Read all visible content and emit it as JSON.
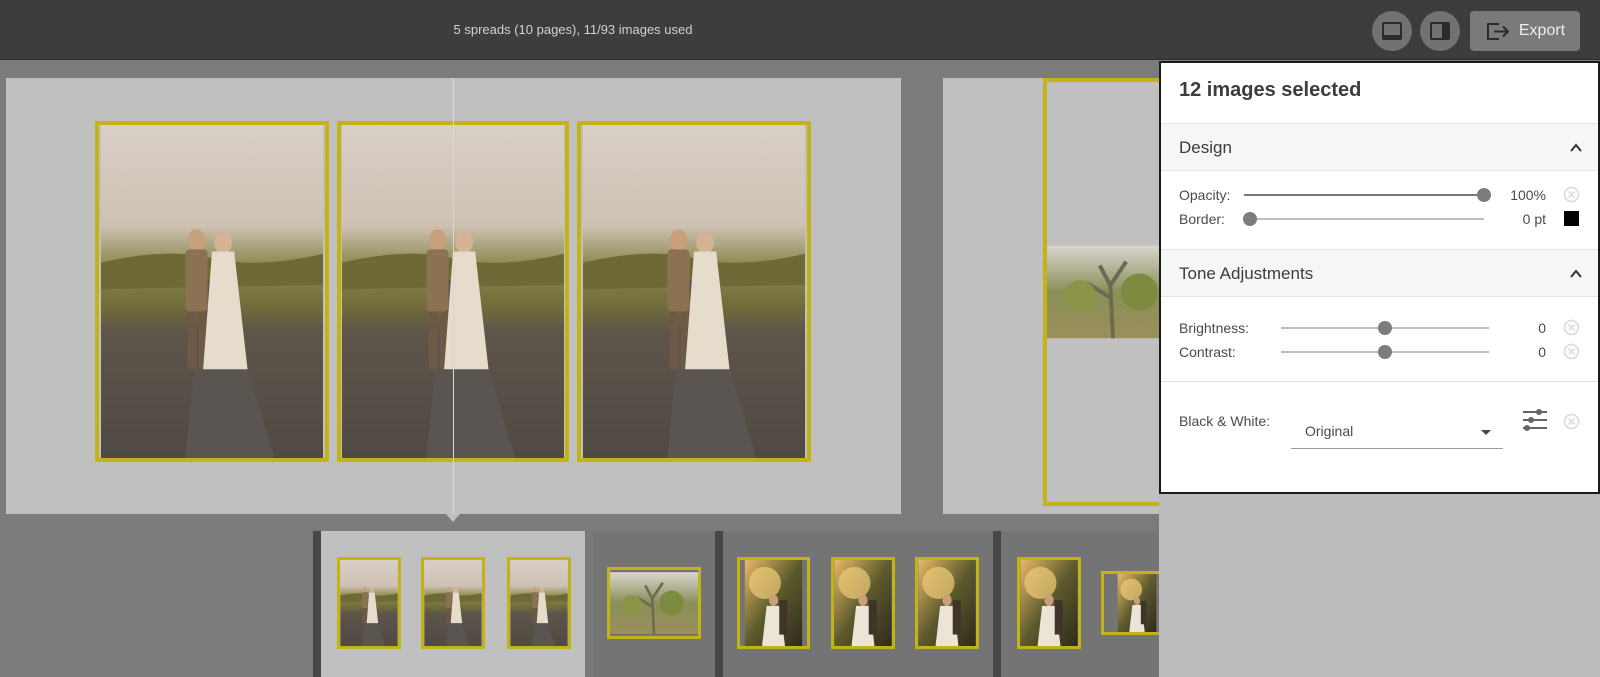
{
  "toolbar": {
    "status": "5 spreads (10 pages), 11/93 images used",
    "single_page_view_icon": "single-page-view-icon",
    "side_panel_view_icon": "side-panel-view-icon",
    "export_label": "Export",
    "export_icon": "export-icon"
  },
  "colors": {
    "selection_border": "#c3b316",
    "topbar": "#3d3d3d",
    "workspace": "#7b7b7b",
    "panel_border": "#1a1a1a"
  },
  "panel": {
    "title": "12 images selected",
    "design": {
      "label": "Design",
      "opacity_label": "Opacity:",
      "opacity_value": "100%",
      "opacity_level": 1.0,
      "border_label": "Border:",
      "border_value": "0 pt",
      "border_level": 0.0,
      "border_color": "#000000"
    },
    "tone": {
      "label": "Tone Adjustments",
      "brightness_label": "Brightness:",
      "brightness_value": "0",
      "brightness_level": 0.5,
      "contrast_label": "Contrast:",
      "contrast_value": "0",
      "contrast_level": 0.5
    },
    "bw": {
      "label": "Black & White:",
      "value": "Original",
      "settings_icon": "sliders-icon"
    }
  }
}
